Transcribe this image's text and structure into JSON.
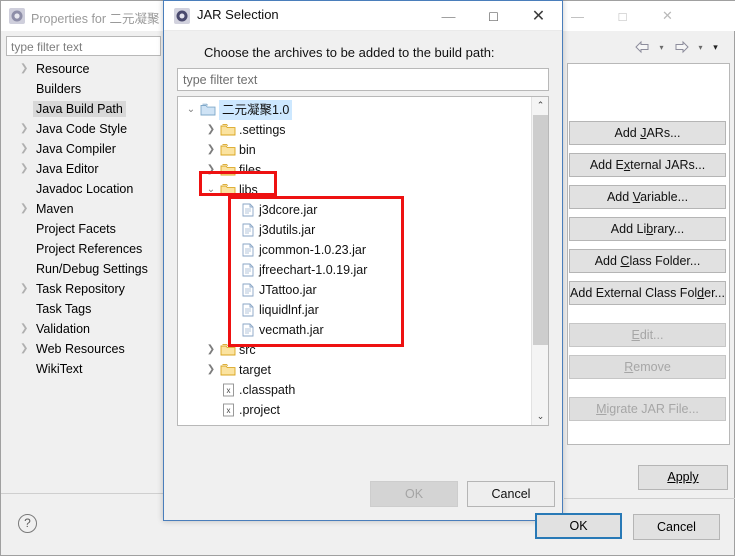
{
  "properties_window": {
    "title": "Properties for 二元凝聚",
    "icon": "eclipse-icon",
    "window_controls": {
      "minimize": "—",
      "maximize": "□",
      "close": "✕"
    },
    "toolbar": {
      "back": "back-arrow-icon",
      "back_menu": "▾",
      "forward": "forward-arrow-icon",
      "forward_menu": "▾",
      "overflow": "▾"
    },
    "filter": {
      "placeholder": "type filter text",
      "value": "type filter text"
    },
    "tree": [
      {
        "label": "Resource",
        "expandable": true,
        "selected": false
      },
      {
        "label": "Builders",
        "expandable": false,
        "selected": false
      },
      {
        "label": "Java Build Path",
        "expandable": false,
        "selected": true
      },
      {
        "label": "Java Code Style",
        "expandable": true,
        "selected": false
      },
      {
        "label": "Java Compiler",
        "expandable": true,
        "selected": false
      },
      {
        "label": "Java Editor",
        "expandable": true,
        "selected": false
      },
      {
        "label": "Javadoc Location",
        "expandable": false,
        "selected": false
      },
      {
        "label": "Maven",
        "expandable": true,
        "selected": false
      },
      {
        "label": "Project Facets",
        "expandable": false,
        "selected": false
      },
      {
        "label": "Project References",
        "expandable": false,
        "selected": false
      },
      {
        "label": "Run/Debug Settings",
        "expandable": false,
        "selected": false
      },
      {
        "label": "Task Repository",
        "expandable": true,
        "selected": false
      },
      {
        "label": "Task Tags",
        "expandable": false,
        "selected": false
      },
      {
        "label": "Validation",
        "expandable": true,
        "selected": false
      },
      {
        "label": "Web Resources",
        "expandable": true,
        "selected": false
      },
      {
        "label": "WikiText",
        "expandable": false,
        "selected": false
      }
    ],
    "help_icon": "?",
    "buttons": [
      {
        "label": "Add JARs...",
        "mnemonic": "J",
        "enabled": true
      },
      {
        "label": "Add External JARs...",
        "mnemonic": "x",
        "enabled": true
      },
      {
        "label": "Add Variable...",
        "mnemonic": "V",
        "enabled": true
      },
      {
        "label": "Add Library...",
        "mnemonic": "b",
        "enabled": true
      },
      {
        "label": "Add Class Folder...",
        "mnemonic": "C",
        "enabled": true
      },
      {
        "label": "Add External Class Folder...",
        "mnemonic": "d",
        "enabled": true
      },
      {
        "label": "Edit...",
        "mnemonic": "E",
        "enabled": false
      },
      {
        "label": "Remove",
        "mnemonic": "R",
        "enabled": false
      },
      {
        "label": "Migrate JAR File...",
        "mnemonic": "M",
        "enabled": false
      }
    ],
    "apply_label": "Apply",
    "ok_label": "OK",
    "cancel_label": "Cancel"
  },
  "jar_dialog": {
    "title": "JAR Selection",
    "icon": "eclipse-icon",
    "window_controls": {
      "minimize": "—",
      "maximize": "□",
      "close": "✕"
    },
    "prompt": "Choose the archives to be added to the build path:",
    "filter": {
      "placeholder": "type filter text",
      "value": "type filter text"
    },
    "tree": [
      {
        "label": "二元凝聚1.0",
        "type": "project",
        "depth": 0,
        "expanded": true,
        "expandable": true,
        "selected": true
      },
      {
        "label": ".settings",
        "type": "folder",
        "depth": 1,
        "expanded": false,
        "expandable": true,
        "selected": false
      },
      {
        "label": "bin",
        "type": "folder",
        "depth": 1,
        "expanded": false,
        "expandable": true,
        "selected": false
      },
      {
        "label": "files",
        "type": "folder",
        "depth": 1,
        "expanded": false,
        "expandable": true,
        "selected": false
      },
      {
        "label": "libs",
        "type": "folder",
        "depth": 1,
        "expanded": true,
        "expandable": true,
        "selected": false
      },
      {
        "label": "j3dcore.jar",
        "type": "jar",
        "depth": 2,
        "expanded": false,
        "expandable": false,
        "selected": false
      },
      {
        "label": "j3dutils.jar",
        "type": "jar",
        "depth": 2,
        "expanded": false,
        "expandable": false,
        "selected": false
      },
      {
        "label": "jcommon-1.0.23.jar",
        "type": "jar",
        "depth": 2,
        "expanded": false,
        "expandable": false,
        "selected": false
      },
      {
        "label": "jfreechart-1.0.19.jar",
        "type": "jar",
        "depth": 2,
        "expanded": false,
        "expandable": false,
        "selected": false
      },
      {
        "label": "JTattoo.jar",
        "type": "jar",
        "depth": 2,
        "expanded": false,
        "expandable": false,
        "selected": false
      },
      {
        "label": "liquidlnf.jar",
        "type": "jar",
        "depth": 2,
        "expanded": false,
        "expandable": false,
        "selected": false
      },
      {
        "label": "vecmath.jar",
        "type": "jar",
        "depth": 2,
        "expanded": false,
        "expandable": false,
        "selected": false
      },
      {
        "label": "src",
        "type": "folder",
        "depth": 1,
        "expanded": false,
        "expandable": true,
        "selected": false
      },
      {
        "label": "target",
        "type": "folder",
        "depth": 1,
        "expanded": false,
        "expandable": true,
        "selected": false
      },
      {
        "label": ".classpath",
        "type": "xml",
        "depth": 1,
        "expanded": false,
        "expandable": false,
        "selected": false
      },
      {
        "label": ".project",
        "type": "xml",
        "depth": 1,
        "expanded": false,
        "expandable": false,
        "selected": false
      }
    ],
    "scrollbar": {
      "up": "⌃",
      "down": "⌄"
    },
    "ok_label": "OK",
    "cancel_label": "Cancel",
    "ok_enabled": false
  },
  "annotations": {
    "color": "#ee1111",
    "boxes": [
      {
        "name": "libs-highlight"
      },
      {
        "name": "jar-files-highlight"
      }
    ]
  }
}
